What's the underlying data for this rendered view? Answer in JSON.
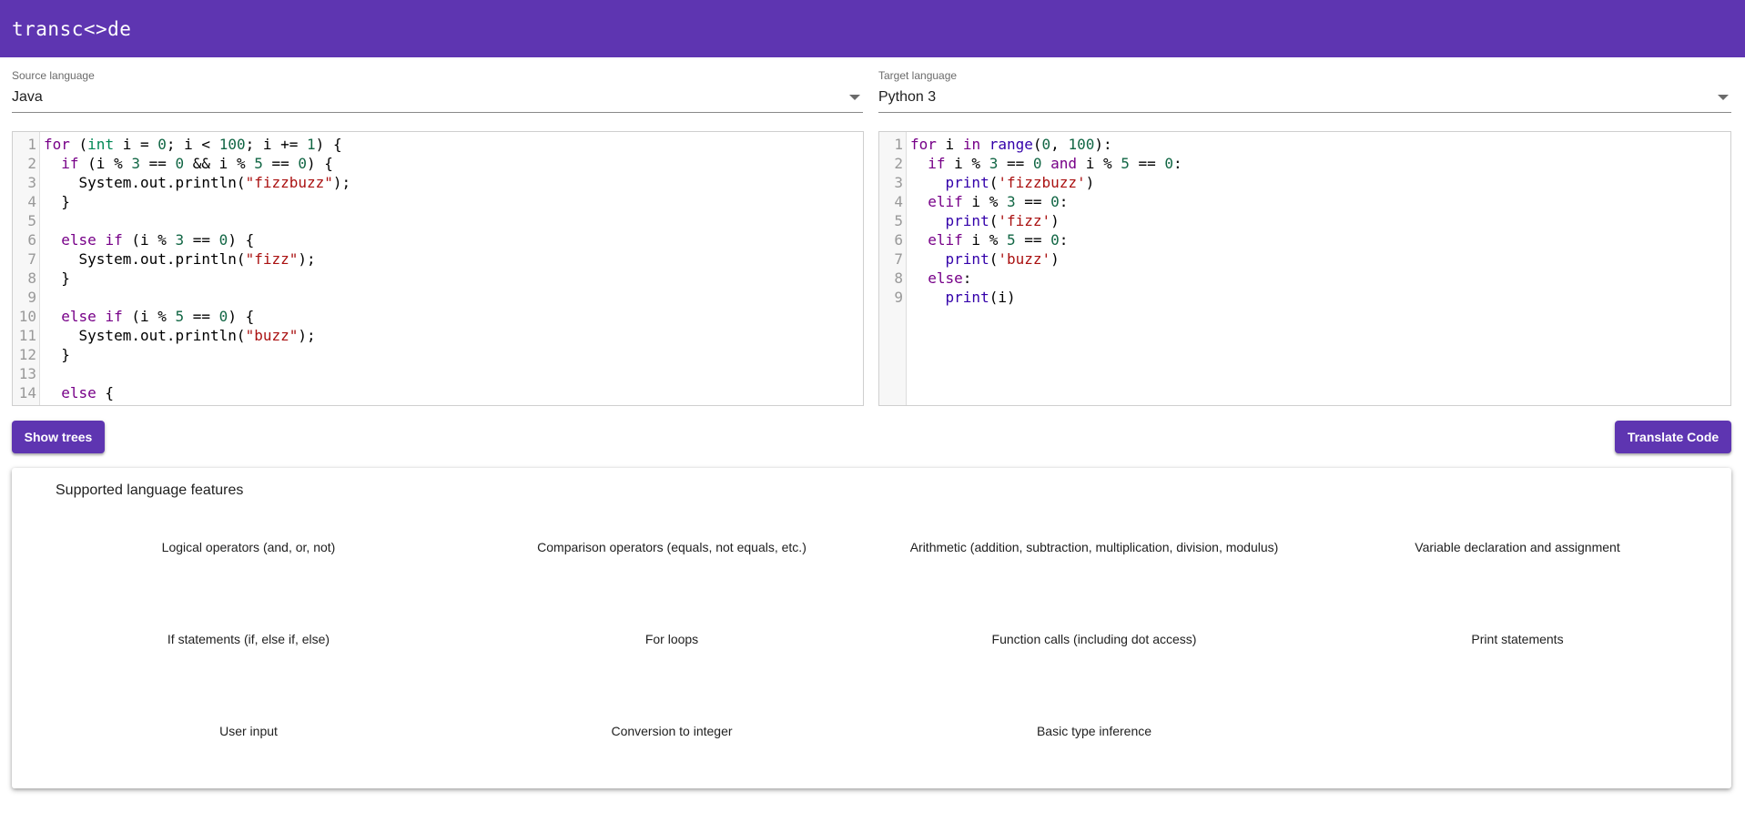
{
  "app": {
    "title": "transc<>de"
  },
  "source": {
    "label": "Source language",
    "value": "Java",
    "lines": [
      [
        {
          "t": "for",
          "c": "kw"
        },
        {
          "t": " ("
        },
        {
          "t": "int",
          "c": "ty"
        },
        {
          "t": " i = "
        },
        {
          "t": "0",
          "c": "num"
        },
        {
          "t": "; i < "
        },
        {
          "t": "100",
          "c": "num"
        },
        {
          "t": "; i += "
        },
        {
          "t": "1",
          "c": "num"
        },
        {
          "t": ") {"
        }
      ],
      [
        {
          "t": "  "
        },
        {
          "t": "if",
          "c": "kw"
        },
        {
          "t": " (i % "
        },
        {
          "t": "3",
          "c": "num"
        },
        {
          "t": " == "
        },
        {
          "t": "0",
          "c": "num"
        },
        {
          "t": " && i % "
        },
        {
          "t": "5",
          "c": "num"
        },
        {
          "t": " == "
        },
        {
          "t": "0",
          "c": "num"
        },
        {
          "t": ") {"
        }
      ],
      [
        {
          "t": "    System.out.println("
        },
        {
          "t": "\"fizzbuzz\"",
          "c": "str"
        },
        {
          "t": ");"
        }
      ],
      [
        {
          "t": "  }"
        }
      ],
      [
        {
          "t": ""
        }
      ],
      [
        {
          "t": "  "
        },
        {
          "t": "else",
          "c": "kw"
        },
        {
          "t": " "
        },
        {
          "t": "if",
          "c": "kw"
        },
        {
          "t": " (i % "
        },
        {
          "t": "3",
          "c": "num"
        },
        {
          "t": " == "
        },
        {
          "t": "0",
          "c": "num"
        },
        {
          "t": ") {"
        }
      ],
      [
        {
          "t": "    System.out.println("
        },
        {
          "t": "\"fizz\"",
          "c": "str"
        },
        {
          "t": ");"
        }
      ],
      [
        {
          "t": "  }"
        }
      ],
      [
        {
          "t": ""
        }
      ],
      [
        {
          "t": "  "
        },
        {
          "t": "else",
          "c": "kw"
        },
        {
          "t": " "
        },
        {
          "t": "if",
          "c": "kw"
        },
        {
          "t": " (i % "
        },
        {
          "t": "5",
          "c": "num"
        },
        {
          "t": " == "
        },
        {
          "t": "0",
          "c": "num"
        },
        {
          "t": ") {"
        }
      ],
      [
        {
          "t": "    System.out.println("
        },
        {
          "t": "\"buzz\"",
          "c": "str"
        },
        {
          "t": ");"
        }
      ],
      [
        {
          "t": "  }"
        }
      ],
      [
        {
          "t": ""
        }
      ],
      [
        {
          "t": "  "
        },
        {
          "t": "else",
          "c": "kw"
        },
        {
          "t": " {"
        }
      ]
    ]
  },
  "target": {
    "label": "Target language",
    "value": "Python 3",
    "lines": [
      [
        {
          "t": "for",
          "c": "kw"
        },
        {
          "t": " i "
        },
        {
          "t": "in",
          "c": "kw"
        },
        {
          "t": " "
        },
        {
          "t": "range",
          "c": "bi"
        },
        {
          "t": "("
        },
        {
          "t": "0",
          "c": "num"
        },
        {
          "t": ", "
        },
        {
          "t": "100",
          "c": "num"
        },
        {
          "t": "):"
        }
      ],
      [
        {
          "t": "  "
        },
        {
          "t": "if",
          "c": "kw"
        },
        {
          "t": " i % "
        },
        {
          "t": "3",
          "c": "num"
        },
        {
          "t": " == "
        },
        {
          "t": "0",
          "c": "num"
        },
        {
          "t": " "
        },
        {
          "t": "and",
          "c": "kw"
        },
        {
          "t": " i % "
        },
        {
          "t": "5",
          "c": "num"
        },
        {
          "t": " == "
        },
        {
          "t": "0",
          "c": "num"
        },
        {
          "t": ":"
        }
      ],
      [
        {
          "t": "    "
        },
        {
          "t": "print",
          "c": "bi"
        },
        {
          "t": "("
        },
        {
          "t": "'fizzbuzz'",
          "c": "str"
        },
        {
          "t": ")"
        }
      ],
      [
        {
          "t": "  "
        },
        {
          "t": "elif",
          "c": "kw"
        },
        {
          "t": " i % "
        },
        {
          "t": "3",
          "c": "num"
        },
        {
          "t": " == "
        },
        {
          "t": "0",
          "c": "num"
        },
        {
          "t": ":"
        }
      ],
      [
        {
          "t": "    "
        },
        {
          "t": "print",
          "c": "bi"
        },
        {
          "t": "("
        },
        {
          "t": "'fizz'",
          "c": "str"
        },
        {
          "t": ")"
        }
      ],
      [
        {
          "t": "  "
        },
        {
          "t": "elif",
          "c": "kw"
        },
        {
          "t": " i % "
        },
        {
          "t": "5",
          "c": "num"
        },
        {
          "t": " == "
        },
        {
          "t": "0",
          "c": "num"
        },
        {
          "t": ":"
        }
      ],
      [
        {
          "t": "    "
        },
        {
          "t": "print",
          "c": "bi"
        },
        {
          "t": "("
        },
        {
          "t": "'buzz'",
          "c": "str"
        },
        {
          "t": ")"
        }
      ],
      [
        {
          "t": "  "
        },
        {
          "t": "else",
          "c": "kw"
        },
        {
          "t": ":"
        }
      ],
      [
        {
          "t": "    "
        },
        {
          "t": "print",
          "c": "bi"
        },
        {
          "t": "(i)"
        }
      ]
    ]
  },
  "buttons": {
    "show_trees": "Show trees",
    "translate": "Translate Code"
  },
  "features": {
    "title": "Supported language features",
    "items": [
      "Logical operators (and, or, not)",
      "Comparison operators (equals, not equals, etc.)",
      "Arithmetic (addition, subtraction, multiplication, division, modulus)",
      "Variable declaration and assignment",
      "If statements (if, else if, else)",
      "For loops",
      "Function calls (including dot access)",
      "Print statements",
      "User input",
      "Conversion to integer",
      "Basic type inference"
    ]
  },
  "colors": {
    "primary": "#5e35b1",
    "keyword": "#770088",
    "number": "#116644",
    "string": "#aa1111",
    "builtin": "#3300aa",
    "type": "#008855"
  }
}
